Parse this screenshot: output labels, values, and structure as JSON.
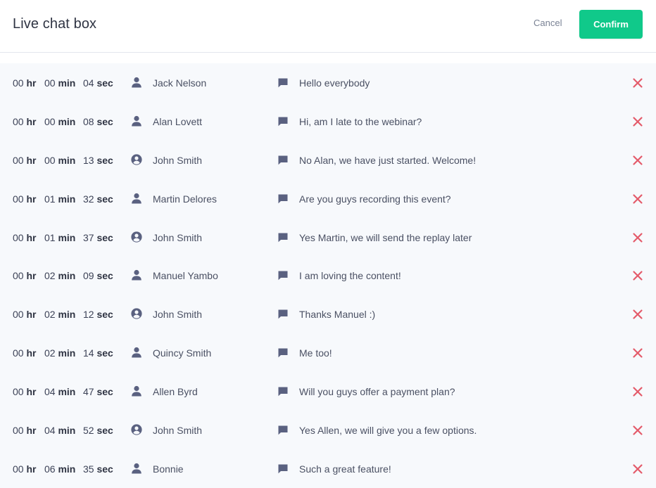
{
  "header": {
    "title": "Live chat box",
    "cancel_label": "Cancel",
    "confirm_label": "Confirm"
  },
  "colors": {
    "confirm": "#10c98a",
    "delete": "#e45b6a",
    "icon": "#5a6180",
    "list_bg": "#f7f9fc"
  },
  "icons": {
    "host_user": "user-circle-icon",
    "attendee_user": "user-icon",
    "message": "chat-bubble-icon",
    "delete": "close-x-icon"
  },
  "units": {
    "hr": "hr",
    "min": "min",
    "sec": "sec"
  },
  "messages": [
    {
      "hr": "00",
      "min": "00",
      "sec": "04",
      "name": "Jack Nelson",
      "role": "attendee",
      "text": "Hello everybody"
    },
    {
      "hr": "00",
      "min": "00",
      "sec": "08",
      "name": "Alan Lovett",
      "role": "attendee",
      "text": "Hi, am I late to the webinar?"
    },
    {
      "hr": "00",
      "min": "00",
      "sec": "13",
      "name": "John Smith",
      "role": "host",
      "text": "No Alan, we have just started. Welcome!"
    },
    {
      "hr": "00",
      "min": "01",
      "sec": "32",
      "name": "Martin Delores",
      "role": "attendee",
      "text": "Are you guys recording this event?"
    },
    {
      "hr": "00",
      "min": "01",
      "sec": "37",
      "name": "John Smith",
      "role": "host",
      "text": "Yes Martin, we will send the replay later"
    },
    {
      "hr": "00",
      "min": "02",
      "sec": "09",
      "name": "Manuel Yambo",
      "role": "attendee",
      "text": "I am loving the content!"
    },
    {
      "hr": "00",
      "min": "02",
      "sec": "12",
      "name": "John Smith",
      "role": "host",
      "text": "Thanks Manuel :)"
    },
    {
      "hr": "00",
      "min": "02",
      "sec": "14",
      "name": "Quincy Smith",
      "role": "attendee",
      "text": "Me too!"
    },
    {
      "hr": "00",
      "min": "04",
      "sec": "47",
      "name": "Allen Byrd",
      "role": "attendee",
      "text": "Will you guys offer a payment plan?"
    },
    {
      "hr": "00",
      "min": "04",
      "sec": "52",
      "name": "John Smith",
      "role": "host",
      "text": "Yes Allen, we will give you a few options."
    },
    {
      "hr": "00",
      "min": "06",
      "sec": "35",
      "name": "Bonnie",
      "role": "attendee",
      "text": "Such a great feature!"
    }
  ]
}
